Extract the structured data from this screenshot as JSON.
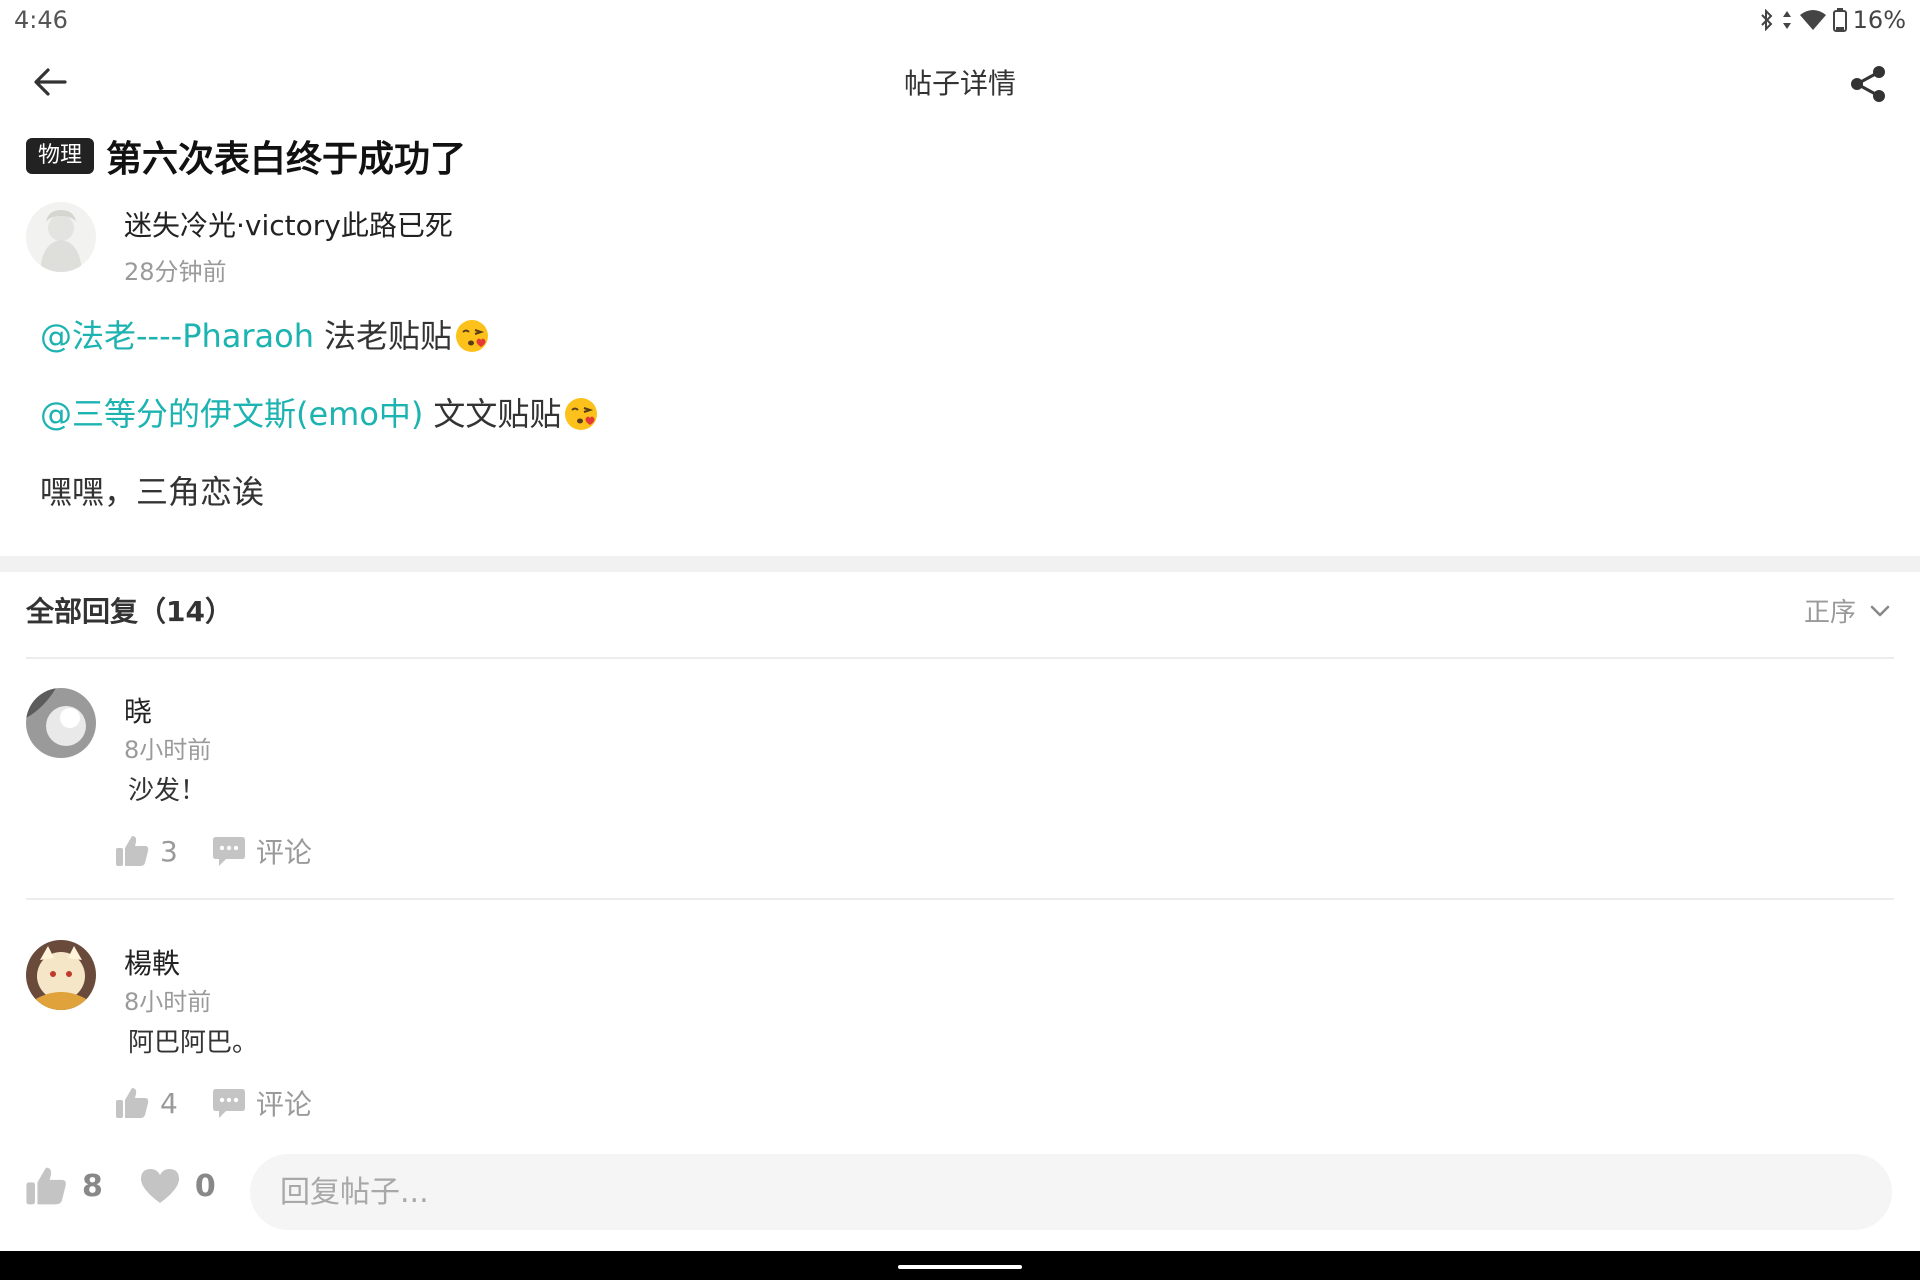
{
  "status_bar": {
    "time": "4:46",
    "battery": "16%"
  },
  "header": {
    "title": "帖子详情"
  },
  "post": {
    "tag": "物理",
    "title": "第六次表白终于成功了",
    "author": "迷失冷光·victory此路已死",
    "time": "28分钟前",
    "lines": [
      {
        "mention": "@法老----Pharaoh",
        "text": "法老贴贴",
        "emoji": "kissing-heart-emoji"
      },
      {
        "mention": "@三等分的伊文斯(emo中)",
        "text": "文文贴贴",
        "emoji": "kissing-heart-emoji"
      },
      {
        "mention": "",
        "text": "嘿嘿，三角恋诶",
        "emoji": ""
      }
    ]
  },
  "replies_section": {
    "title": "全部回复（14）",
    "sort_label": "正序",
    "items": [
      {
        "name": "晓",
        "time": "8小时前",
        "content": "沙发！",
        "likes": "3",
        "comment_label": "评论"
      },
      {
        "name": "楊軼",
        "time": "8小时前",
        "content": "阿巴阿巴。",
        "likes": "4",
        "comment_label": "评论"
      }
    ]
  },
  "bottom_bar": {
    "likes": "8",
    "favorites": "0",
    "reply_placeholder": "回复帖子..."
  },
  "colors": {
    "mention": "#1cb3b0",
    "tag_bg": "#222222",
    "muted": "#9a9a9a"
  },
  "icons": [
    "back-arrow-icon",
    "share-icon",
    "thumb-up-icon",
    "comment-icon",
    "heart-icon",
    "chevron-down-icon"
  ]
}
